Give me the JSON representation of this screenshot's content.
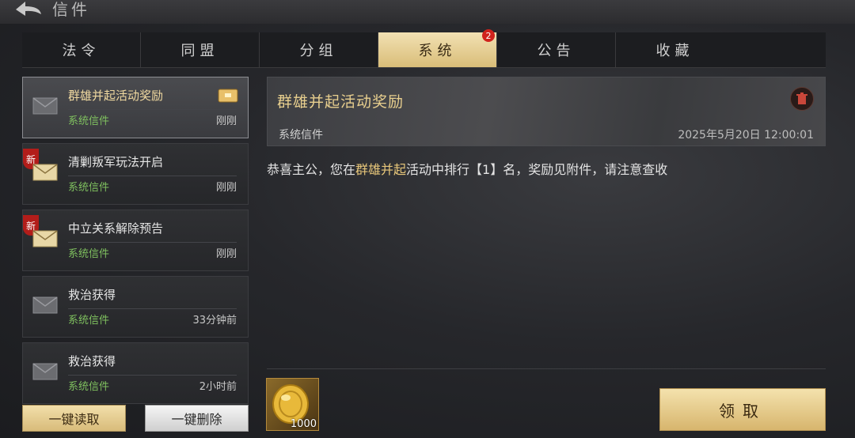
{
  "header": {
    "title": "信件"
  },
  "tabs": [
    {
      "label": "法令"
    },
    {
      "label": "同盟"
    },
    {
      "label": "分组"
    },
    {
      "label": "系统",
      "badge": "2"
    },
    {
      "label": "公告"
    },
    {
      "label": "收藏"
    }
  ],
  "active_tab": "系统",
  "mail_list": [
    {
      "subject": "群雄并起活动奖励",
      "type": "系统信件",
      "time": "刚刚"
    },
    {
      "subject": "清剿叛军玩法开启",
      "type": "系统信件",
      "time": "刚刚",
      "new_tag": "新"
    },
    {
      "subject": "中立关系解除预告",
      "type": "系统信件",
      "time": "刚刚",
      "new_tag": "新"
    },
    {
      "subject": "救治获得",
      "type": "系统信件",
      "time": "33分钟前"
    },
    {
      "subject": "救治获得",
      "type": "系统信件",
      "time": "2小时前"
    }
  ],
  "list_buttons": {
    "read_all": "一键读取",
    "delete_all": "一键删除"
  },
  "detail": {
    "title": "群雄并起活动奖励",
    "sender": "系统信件",
    "date": "2025年5月20日 12:00:01",
    "body_prefix": "恭喜主公，您在",
    "body_highlight": "群雄并起",
    "body_suffix": "活动中排行【1】名，奖励见附件，请注意查收"
  },
  "attachment": {
    "icon": "gold-coin-icon",
    "quantity": "1000"
  },
  "claim_button": "领取",
  "colors": {
    "accent_gold": "#e8c77a",
    "system_green": "#7fc05f",
    "badge_red": "#d0221c"
  }
}
